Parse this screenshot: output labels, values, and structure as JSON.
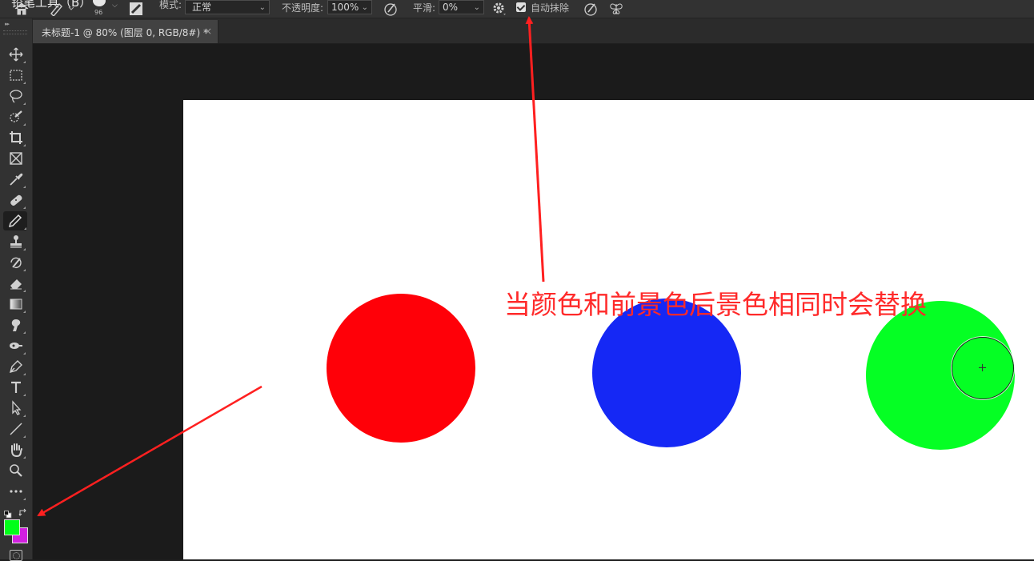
{
  "options_bar": {
    "cut_title": "铅笔工具（B）",
    "brush_size": "96",
    "mode_label": "模式:",
    "mode_value": "正常",
    "opacity_label": "不透明度:",
    "opacity_value": "100%",
    "smoothing_label": "平滑:",
    "smoothing_value": "0%",
    "auto_erase_label": "自动抹除",
    "auto_erase_checked": true
  },
  "toolbar": {
    "tools": [
      {
        "name": "move-tool",
        "icon": "move-icon"
      },
      {
        "name": "marquee-tool",
        "icon": "marquee-icon"
      },
      {
        "name": "lasso-tool",
        "icon": "lasso-icon"
      },
      {
        "name": "quick-select-tool",
        "icon": "quick-select-icon"
      },
      {
        "name": "crop-tool",
        "icon": "crop-icon"
      },
      {
        "name": "frame-tool",
        "icon": "frame-icon"
      },
      {
        "name": "eyedropper-tool",
        "icon": "eyedropper-icon"
      },
      {
        "name": "healing-brush-tool",
        "icon": "bandage-icon"
      },
      {
        "name": "pencil-tool",
        "icon": "pencil-icon",
        "active": true
      },
      {
        "name": "clone-stamp-tool",
        "icon": "stamp-icon"
      },
      {
        "name": "history-brush-tool",
        "icon": "history-brush-icon"
      },
      {
        "name": "eraser-tool",
        "icon": "eraser-icon"
      },
      {
        "name": "gradient-tool",
        "icon": "gradient-icon"
      },
      {
        "name": "smudge-tool",
        "icon": "smudge-icon"
      },
      {
        "name": "dodge-tool",
        "icon": "dodge-icon"
      },
      {
        "name": "pen-tool",
        "icon": "pen-icon"
      },
      {
        "name": "type-tool",
        "icon": "type-icon"
      },
      {
        "name": "path-select-tool",
        "icon": "arrow-icon"
      },
      {
        "name": "line-tool",
        "icon": "line-icon"
      },
      {
        "name": "hand-tool",
        "icon": "hand-icon"
      },
      {
        "name": "zoom-tool",
        "icon": "zoom-icon"
      },
      {
        "name": "more-tools",
        "icon": "ellipsis-icon"
      }
    ],
    "foreground_color": "#00ff19",
    "background_color": "#d21fe0"
  },
  "document_tab": {
    "title": "未标题-1 @ 80% (图层 0, RGB/8#) *",
    "close": "×"
  },
  "canvas": {
    "circles": [
      {
        "name": "red-circle",
        "color": "#ff0008"
      },
      {
        "name": "blue-circle",
        "color": "#1528f5"
      },
      {
        "name": "green-circle",
        "color": "#05ff24"
      }
    ]
  },
  "annotation": {
    "text": "当颜色和前景色后景色相同时会替换",
    "color": "#ff2a2a"
  }
}
